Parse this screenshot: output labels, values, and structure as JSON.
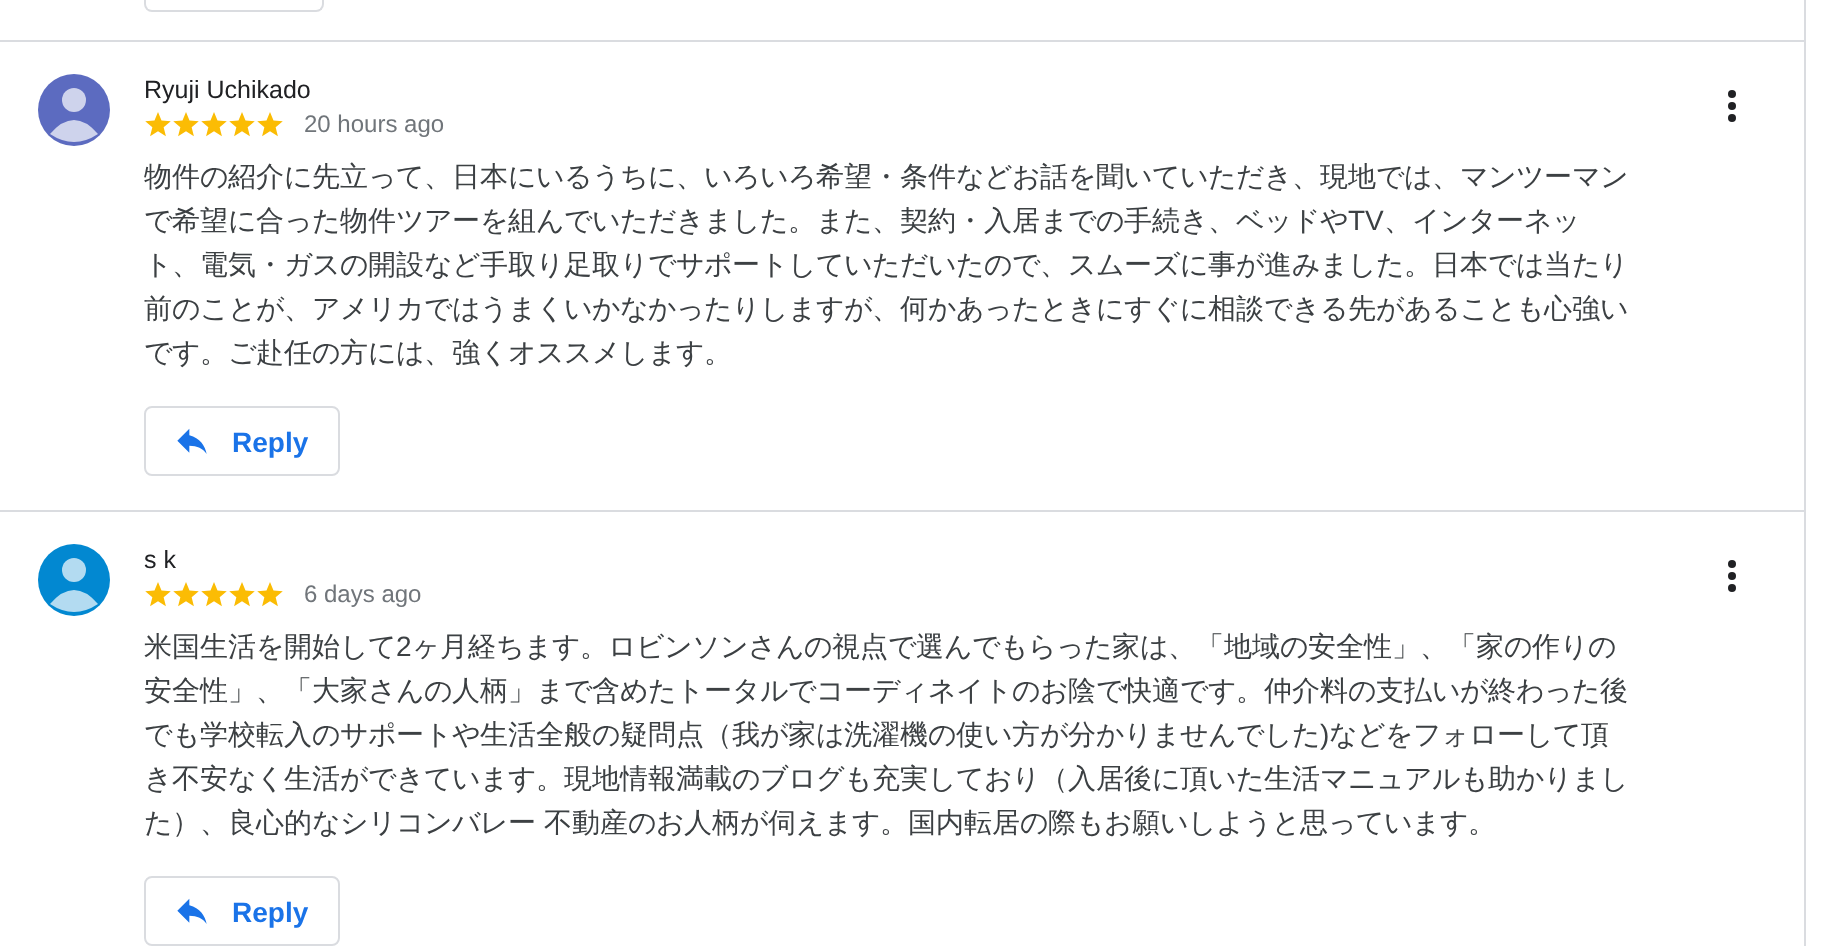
{
  "reviews": [
    {
      "author": "Ryuji Uchikado",
      "color": "#5c6bc0",
      "stars": 5,
      "time": "20 hours ago",
      "text": "物件の紹介に先立って、日本にいるうちに、いろいろ希望・条件などお話を聞いていただき、現地では、マンツーマンで希望に合った物件ツアーを組んでいただきました。また、契約・入居までの手続き、ベッドやTV、インターネット、電気・ガスの開設など手取り足取りでサポートしていただいたので、スムーズに事が進みました。日本では当たり前のことが、アメリカではうまくいかなかったりしますが、何かあったときにすぐに相談できる先があることも心強いです。ご赴任の方には、強くオススメします。",
      "reply_label": "Reply"
    },
    {
      "author": "s k",
      "color": "#0288d1",
      "stars": 5,
      "time": "6 days ago",
      "text": "米国生活を開始して2ヶ月経ちます。ロビンソンさんの視点で選んでもらった家は、「地域の安全性」、「家の作りの安全性」、「大家さんの人柄」まで含めたトータルでコーディネイトのお陰で快適です。仲介料の支払いが終わった後でも学校転入のサポートや生活全般の疑問点（我が家は洗濯機の使い方が分かりませんでした)などをフォローして頂き不安なく生活ができています。現地情報満載のブログも充実しており（入居後に頂いた生活マニュアルも助かりました）、良心的なシリコンバレー 不動産のお人柄が伺えます。国内転居の際もお願いしようと思っています。",
      "reply_label": "Reply"
    }
  ]
}
